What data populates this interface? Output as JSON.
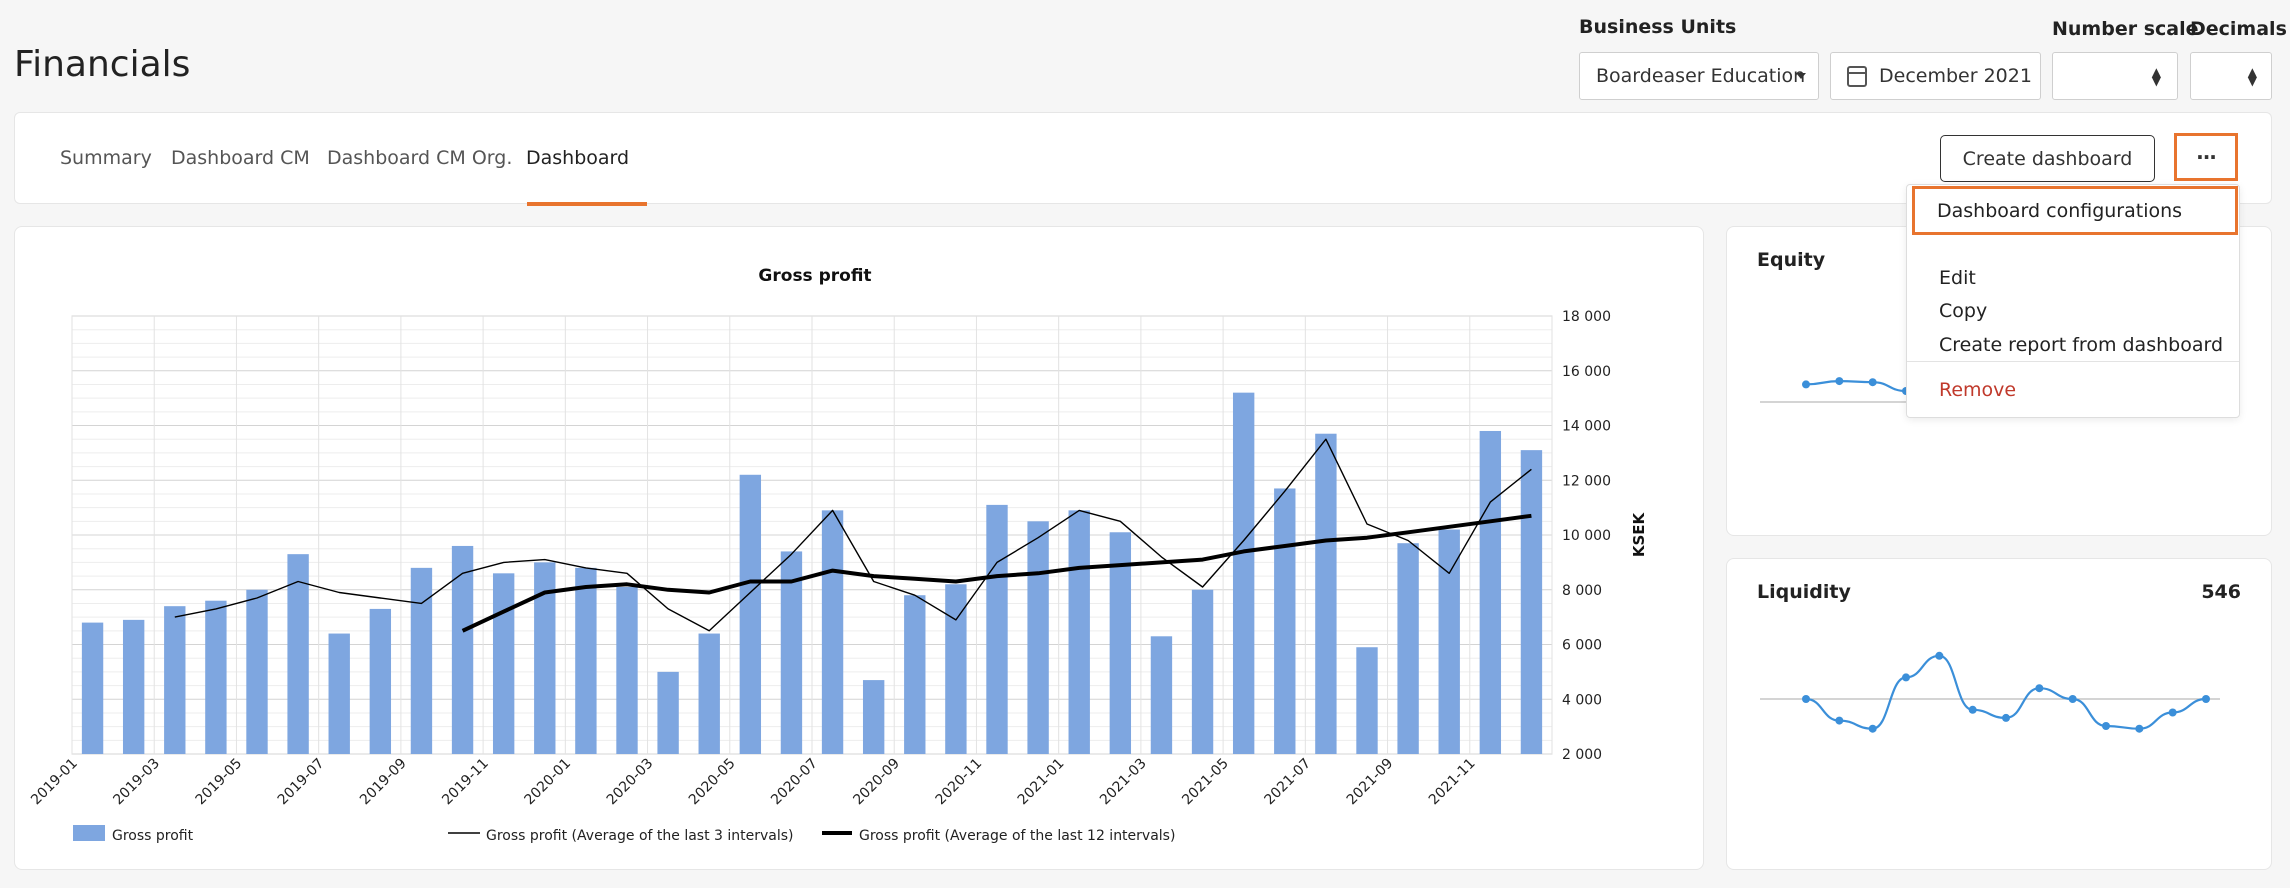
{
  "page": {
    "title": "Financials"
  },
  "controls": {
    "business_units_label": "Business Units",
    "business_units_value": "Boardeaser Education",
    "date_value": "December 2021",
    "number_scale_label": "Number scale",
    "number_scale_value": "",
    "decimals_label": "Decimals",
    "decimals_value": ""
  },
  "tabs": [
    {
      "label": "Summary",
      "active": false
    },
    {
      "label": "Dashboard CM",
      "active": false
    },
    {
      "label": "Dashboard CM Org.",
      "active": false
    },
    {
      "label": "Dashboard",
      "active": true
    }
  ],
  "toolbar": {
    "create_label": "Create dashboard",
    "more_label": "···"
  },
  "menu": {
    "items": [
      {
        "label": "Dashboard configurations",
        "highlighted": true
      },
      {
        "label": "Edit"
      },
      {
        "label": "Copy"
      },
      {
        "label": "Create report from dashboard"
      },
      {
        "label": "Remove",
        "danger": true
      }
    ]
  },
  "widgets": {
    "equity": {
      "title": "Equity"
    },
    "liquidity": {
      "title": "Liquidity",
      "value": "546"
    }
  },
  "colors": {
    "accent": "#e8742e",
    "bar": "#7ea6e0",
    "sparkline": "#3b8fd9",
    "danger": "#c0392b"
  },
  "chart_data": {
    "type": "bar",
    "title": "Gross profit",
    "ylabel": "KSEK",
    "ylim": [
      2000,
      18000
    ],
    "yticks": [
      2000,
      4000,
      6000,
      8000,
      10000,
      12000,
      14000,
      16000,
      18000
    ],
    "ytick_labels": [
      "2 000",
      "4 000",
      "6 000",
      "8 000",
      "10 000",
      "12 000",
      "14 000",
      "16 000",
      "18 000"
    ],
    "xtick_labels": [
      "2019-01",
      "2019-03",
      "2019-05",
      "2019-07",
      "2019-09",
      "2019-11",
      "2020-01",
      "2020-03",
      "2020-05",
      "2020-07",
      "2020-09",
      "2020-11",
      "2021-01",
      "2021-03",
      "2021-05",
      "2021-07",
      "2021-09",
      "2021-11"
    ],
    "categories": [
      "2019-01",
      "2019-02",
      "2019-03",
      "2019-04",
      "2019-05",
      "2019-06",
      "2019-07",
      "2019-08",
      "2019-09",
      "2019-10",
      "2019-11",
      "2019-12",
      "2020-01",
      "2020-02",
      "2020-03",
      "2020-04",
      "2020-05",
      "2020-06",
      "2020-07",
      "2020-08",
      "2020-09",
      "2020-10",
      "2020-11",
      "2020-12",
      "2021-01",
      "2021-02",
      "2021-03",
      "2021-04",
      "2021-05",
      "2021-06",
      "2021-07",
      "2021-08",
      "2021-09",
      "2021-10",
      "2021-11",
      "2021-12"
    ],
    "grid": true,
    "legend_position": "bottom",
    "series": [
      {
        "name": "Gross profit",
        "kind": "bar",
        "values": [
          6800,
          6900,
          7400,
          7600,
          8000,
          9300,
          6400,
          7300,
          8800,
          9600,
          8600,
          9000,
          8800,
          8100,
          5000,
          6400,
          12200,
          9400,
          10900,
          4700,
          7800,
          8200,
          11100,
          10500,
          10900,
          10100,
          6300,
          8000,
          15200,
          11700,
          13700,
          5900,
          9700,
          10200,
          13800,
          13100
        ]
      },
      {
        "name": "Gross profit (Average of the last 3 intervals)",
        "kind": "line",
        "values": [
          null,
          null,
          7000,
          7300,
          7700,
          8300,
          7900,
          7700,
          7500,
          8600,
          9000,
          9100,
          8800,
          8600,
          7300,
          6500,
          7900,
          9300,
          10900,
          8300,
          7800,
          6900,
          9000,
          9900,
          10900,
          10500,
          9200,
          8100,
          9800,
          11600,
          13500,
          10400,
          9800,
          8600,
          11200,
          12400
        ]
      },
      {
        "name": "Gross profit (Average of the last 12 intervals)",
        "kind": "line",
        "values": [
          null,
          null,
          null,
          null,
          null,
          null,
          null,
          null,
          null,
          6500,
          7200,
          7900,
          8100,
          8200,
          8000,
          7900,
          8300,
          8300,
          8700,
          8500,
          8400,
          8300,
          8500,
          8600,
          8800,
          8900,
          9000,
          9100,
          9400,
          9600,
          9800,
          9900,
          10100,
          10300,
          10500,
          10700
        ]
      }
    ]
  },
  "sparklines": {
    "equity": {
      "values": [
        8,
        9.5,
        9,
        5
      ]
    },
    "liquidity": {
      "values": [
        0,
        -8,
        -11,
        8,
        16,
        -4,
        -7,
        4,
        0,
        -10,
        -11,
        -5,
        0
      ]
    }
  }
}
